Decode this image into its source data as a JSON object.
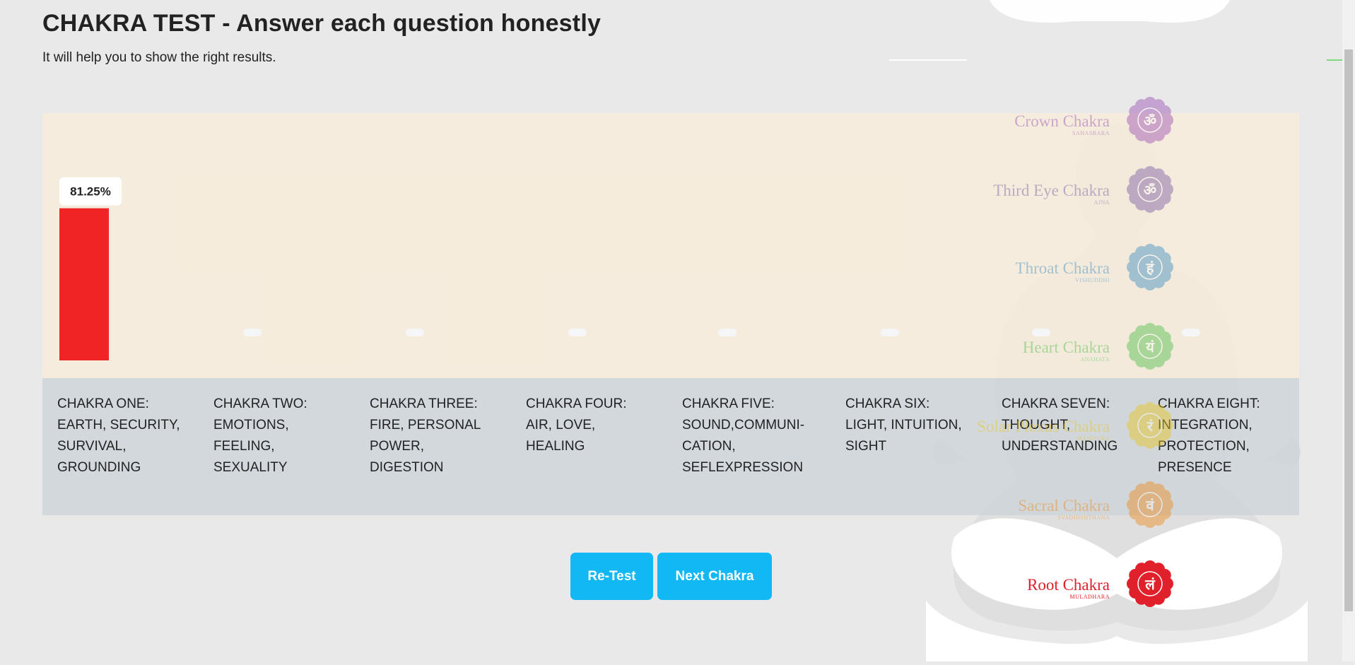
{
  "header": {
    "title": "CHAKRA TEST - Answer each question honestly",
    "subtitle": "It will help you to show the right results."
  },
  "colors": {
    "bar": "#f02424",
    "accent_button": "#12b8f3",
    "chart_background": "#f7ecda",
    "label_background": "#ced4d9"
  },
  "chart_data": {
    "type": "bar",
    "categories": [
      "CHAKRA ONE: EARTH, SECURITY, SURVIVAL, GROUNDING",
      "CHAKRA TWO: EMOTIONS, FEELING, SEXUALITY",
      "CHAKRA THREE: FIRE, PERSONAL POWER, DIGESTION",
      "CHAKRA FOUR: AIR, LOVE, HEALING",
      "CHAKRA FIVE: SOUND,COMMUNI-CATION, SEFLEXPRESSION",
      "CHAKRA SIX: LIGHT, INTUITION, SIGHT",
      "CHAKRA SEVEN: THOUGHT, UNDERSTANDING",
      "CHAKRA EIGHT: INTEGRATION, PROTECTION, PRESENCE"
    ],
    "category_lines": [
      "CHAKRA ONE:\nEARTH, SECURITY,\nSURVIVAL,\nGROUNDING",
      "CHAKRA TWO:\nEMOTIONS,\nFEELING,\nSEXUALITY",
      "CHAKRA THREE:\nFIRE, PERSONAL\nPOWER,\nDIGESTION",
      "CHAKRA FOUR:\nAIR, LOVE,\nHEALING",
      "CHAKRA FIVE:\nSOUND,COMMUNI-\nCATION,\nSEFLEXPRESSION",
      "CHAKRA SIX:\nLIGHT, INTUITION,\nSIGHT",
      "CHAKRA SEVEN:\nTHOUGHT,\nUNDERSTANDING",
      "CHAKRA EIGHT:\nINTEGRATION,\nPROTECTION,\nPRESENCE"
    ],
    "values": [
      81.25,
      0,
      0,
      0,
      0,
      0,
      0,
      0
    ],
    "data_labels": [
      "81.25%",
      "",
      "",
      "",
      "",
      "",
      "",
      ""
    ],
    "ylim": [
      0,
      100
    ],
    "grid": false,
    "title": "",
    "xlabel": "",
    "ylabel": ""
  },
  "chakras": [
    {
      "name": "Crown Chakra",
      "sub": "SAHASRARA",
      "color": "#9b4fb5",
      "glyph": "ॐ",
      "icon": "lotus-icon"
    },
    {
      "name": "Third Eye Chakra",
      "sub": "AJNA",
      "color": "#7a5aa0",
      "glyph": "ॐ",
      "icon": "lotus-icon"
    },
    {
      "name": "Throat Chakra",
      "sub": "VISHUDDHI",
      "color": "#3d8fc2",
      "glyph": "हं",
      "icon": "lotus-icon"
    },
    {
      "name": "Heart Chakra",
      "sub": "ANAHATA",
      "color": "#4fbf4a",
      "glyph": "यं",
      "icon": "lotus-icon"
    },
    {
      "name": "Solar Plexus Chakra",
      "sub": "MANIPURA",
      "color": "#e8c61c",
      "glyph": "रं",
      "icon": "lotus-icon"
    },
    {
      "name": "Sacral Chakra",
      "sub": "SVADHISHTHANA",
      "color": "#ef8a1a",
      "glyph": "वं",
      "icon": "lotus-icon"
    },
    {
      "name": "Root Chakra",
      "sub": "MULADHARA",
      "color": "#e0202a",
      "glyph": "लं",
      "icon": "lotus-icon"
    }
  ],
  "buttons": {
    "retest": "Re-Test",
    "next": "Next Chakra"
  }
}
